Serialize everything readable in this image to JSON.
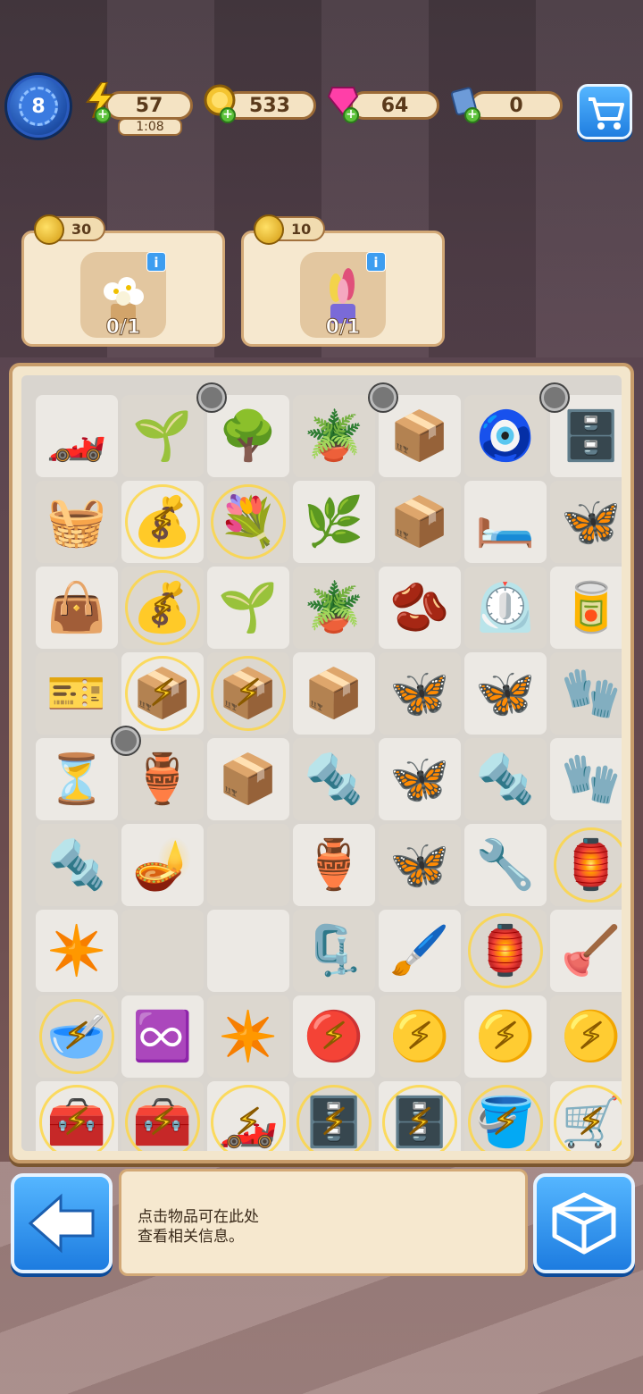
{
  "hud": {
    "level": "8",
    "energy": "57",
    "energy_timer": "1:08",
    "coins": "533",
    "gems": "64",
    "tickets": "0"
  },
  "orders": [
    {
      "reward": "30",
      "progress": "0/1",
      "item": "white-flower-pot"
    },
    {
      "reward": "10",
      "progress": "0/1",
      "item": "hyacinth-pot"
    }
  ],
  "info_panel": {
    "line1": "点击物品可在此处",
    "line2": "查看相关信息。"
  },
  "board": {
    "rows": [
      [
        "toy-race-car",
        "sapling",
        "young-tree",
        "potted-plant",
        "wooden-crates",
        "gold-locket",
        "wooden-dresser"
      ],
      [
        "seed-sacks",
        "energy-sack",
        "flower-bouquet",
        "sprout",
        "seed-box",
        "pillows",
        "brown-moth"
      ],
      [
        "seed-bag",
        "energy-sack",
        "potted-seedling",
        "potted-sapling",
        "seeds",
        "timer-device",
        "paint-can"
      ],
      [
        "seed-packet",
        "energy-box",
        "energy-box",
        "glove-box",
        "hawk-moth",
        "white-moth",
        "leather-gloves"
      ],
      [
        "hourglass-bubble",
        "pink-vase",
        "glove-box",
        "screws",
        "blue-butterfly",
        "bolt-stud",
        "garden-gloves"
      ],
      [
        "screw",
        "clay-lamp",
        "",
        "clay-pot",
        "tan-moth",
        "wrench",
        "lantern"
      ],
      [
        "blue-star",
        "",
        "",
        "pliers",
        "paintbrush",
        "lantern",
        "plunger"
      ],
      [
        "energy-bowl",
        "infinity-bubble",
        "blue-star",
        "energy-bubble-red",
        "energy-bubble",
        "energy-bubble",
        "energy-bubble"
      ],
      [
        "energy-toolbox",
        "energy-toolbox-red",
        "energy-race-car",
        "energy-shelf",
        "energy-shelf",
        "energy-bucket",
        "energy-cart"
      ]
    ]
  }
}
